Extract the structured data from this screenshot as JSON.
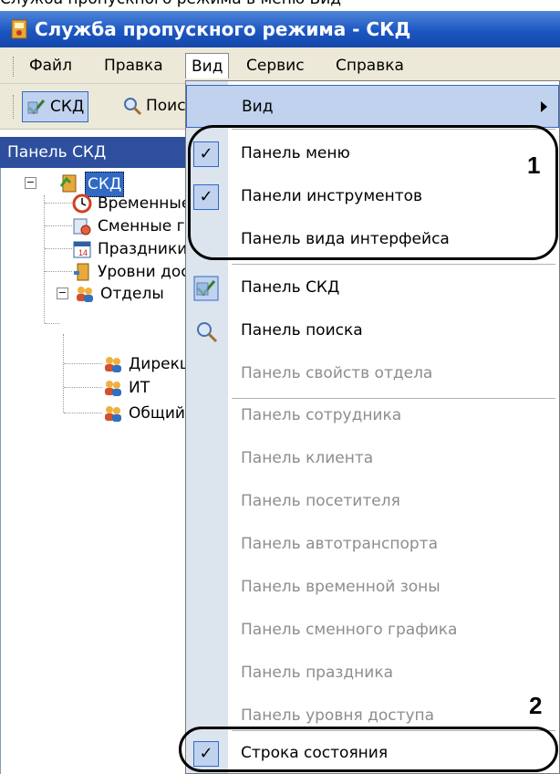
{
  "caption": "Служба пропускного режима в меню Вид",
  "window": {
    "title": "Служба пропускного режима - СКД"
  },
  "menubar": [
    {
      "label": "Файл",
      "active": false
    },
    {
      "label": "Правка",
      "active": false
    },
    {
      "label": "Вид",
      "active": true
    },
    {
      "label": "Сервис",
      "active": false
    },
    {
      "label": "Справка",
      "active": false
    }
  ],
  "toolbar": {
    "skd_label": "СКД",
    "search_label": "Поиск"
  },
  "panel": {
    "header": "Панель СКД"
  },
  "tree": {
    "root": "СКД",
    "children": [
      "Временные зоны",
      "Сменные графики",
      "Праздники",
      "Уровни доступа",
      "Отделы"
    ],
    "departments": [
      "Дирекция",
      "ИТ",
      "Общий"
    ]
  },
  "dropdown": {
    "items": [
      {
        "label": "Вид",
        "checked": false,
        "disabled": false,
        "submenu": true,
        "icon": ""
      },
      {
        "label": "Панель меню",
        "checked": true,
        "disabled": false,
        "submenu": false,
        "icon": ""
      },
      {
        "label": "Панели инструментов",
        "checked": true,
        "disabled": false,
        "submenu": false,
        "icon": ""
      },
      {
        "label": "Панель вида интерфейса",
        "checked": false,
        "disabled": false,
        "submenu": false,
        "icon": ""
      },
      {
        "label": "Панель СКД",
        "checked": false,
        "disabled": false,
        "submenu": false,
        "icon": "skd-icon"
      },
      {
        "label": "Панель поиска",
        "checked": false,
        "disabled": false,
        "submenu": false,
        "icon": "search-icon"
      },
      {
        "label": "Панель свойств отдела",
        "checked": false,
        "disabled": true,
        "submenu": false,
        "icon": ""
      },
      {
        "label": "Панель сотрудника",
        "checked": false,
        "disabled": true,
        "submenu": false,
        "icon": ""
      },
      {
        "label": "Панель клиента",
        "checked": false,
        "disabled": true,
        "submenu": false,
        "icon": ""
      },
      {
        "label": "Панель посетителя",
        "checked": false,
        "disabled": true,
        "submenu": false,
        "icon": ""
      },
      {
        "label": "Панель автотранспорта",
        "checked": false,
        "disabled": true,
        "submenu": false,
        "icon": ""
      },
      {
        "label": "Панель временной зоны",
        "checked": false,
        "disabled": true,
        "submenu": false,
        "icon": ""
      },
      {
        "label": "Панель сменного графика",
        "checked": false,
        "disabled": true,
        "submenu": false,
        "icon": ""
      },
      {
        "label": "Панель праздника",
        "checked": false,
        "disabled": true,
        "submenu": false,
        "icon": ""
      },
      {
        "label": "Панель уровня доступа",
        "checked": false,
        "disabled": true,
        "submenu": false,
        "icon": ""
      },
      {
        "label": "Строка состояния",
        "checked": true,
        "disabled": false,
        "submenu": false,
        "icon": ""
      }
    ]
  },
  "callouts": {
    "one": "1",
    "two": "2"
  },
  "colors": {
    "titlebar": "#1c56c2",
    "menu_highlight": "#c1d2ee",
    "selection": "#316ac5",
    "disabled_text": "#8d8d8d"
  }
}
